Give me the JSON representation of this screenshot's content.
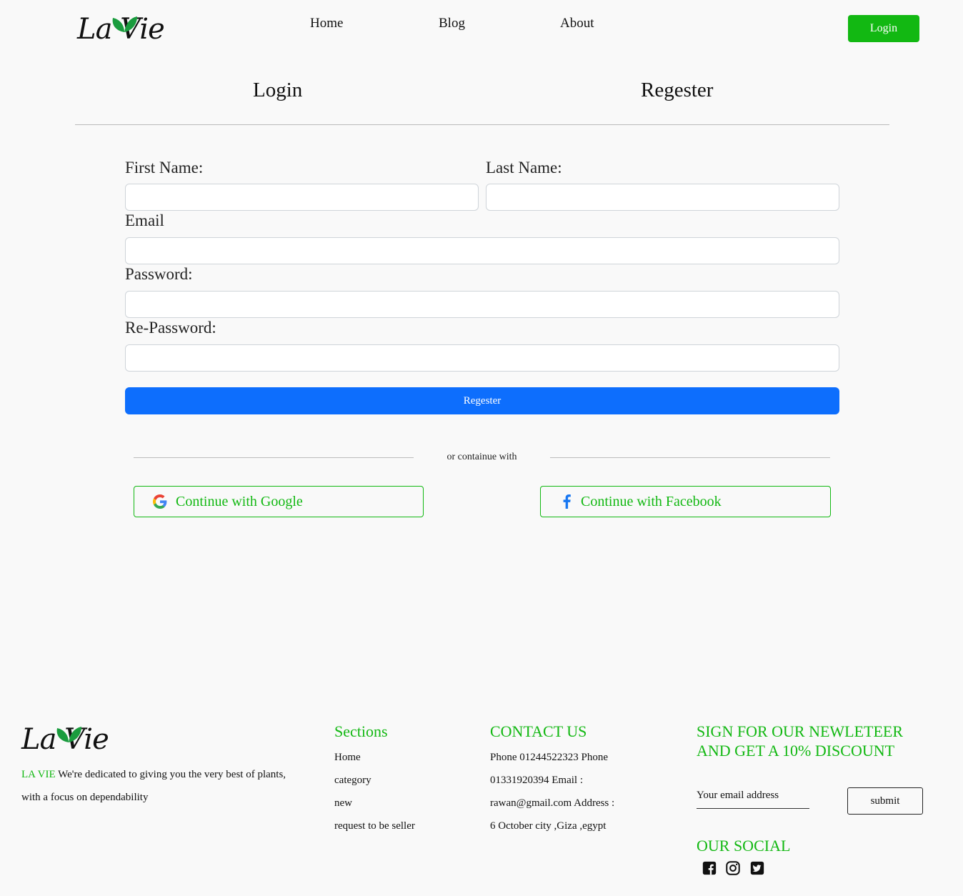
{
  "header": {
    "logo_text": "La Vie",
    "nav": [
      "Home",
      "Blog",
      "About"
    ],
    "login_label": "Login"
  },
  "tabs": {
    "login": "Login",
    "register": "Regester"
  },
  "form": {
    "first_name_label": "First Name:",
    "last_name_label": "Last Name:",
    "email_label": "Email",
    "password_label": "Password:",
    "repassword_label": "Re-Password:",
    "submit_label": "Regester"
  },
  "divider_text": "or containue with",
  "social_login": {
    "google_label": "Continue with Google",
    "facebook_label": "Continue with Facebook"
  },
  "footer": {
    "logo_text": "La Vie",
    "brand": "LA VIE",
    "about_line1": "We're dedicated to giving you the very best of plants,",
    "about_line2": "with a focus on dependability",
    "sections_title": "Sections",
    "sections": [
      "Home",
      "category",
      "new",
      "request to be seller"
    ],
    "contact_title": "CONTACT US",
    "contact_lines": [
      "Phone 01244522323 Phone",
      "01331920394 Email :",
      "rawan@gmail.com Address :",
      "6 October city ,Giza ,egypt"
    ],
    "newsletter_title_1": "SIGN FOR OUR NEWLETEER",
    "newsletter_title_2": "AND GET A 10% DISCOUNT",
    "email_placeholder": "Your email address",
    "submit_label": "submit",
    "social_title": "OUR SOCIAL",
    "social_icons": [
      "facebook-icon",
      "instagram-icon",
      "twitter-icon"
    ]
  },
  "colors": {
    "brand_green": "#12b812",
    "primary_blue": "#0d6efd",
    "leaf_green": "#1a9c3e",
    "background": "#f9f9f9"
  }
}
